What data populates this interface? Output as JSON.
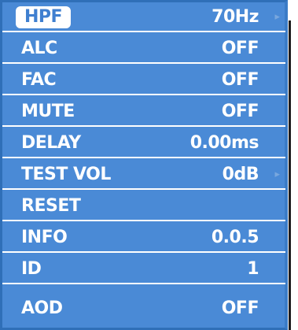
{
  "menu": {
    "items": [
      {
        "label": "HPF",
        "value": "70Hz"
      },
      {
        "label": "ALC",
        "value": "OFF"
      },
      {
        "label": "FAC",
        "value": "OFF"
      },
      {
        "label": "MUTE",
        "value": "OFF"
      },
      {
        "label": "DELAY",
        "value": "0.00ms"
      },
      {
        "label": "TEST VOL",
        "value": "0dB"
      },
      {
        "label": "RESET",
        "value": ""
      },
      {
        "label": "INFO",
        "value": "0.0.5"
      },
      {
        "label": "ID",
        "value": "1"
      },
      {
        "label": "AOD",
        "value": "OFF"
      }
    ]
  },
  "colors": {
    "panel": "#4a8ad6",
    "border": "#2f6fb8",
    "highlight_text": "#3f7fd0",
    "scroll_track": "#1d1d1f"
  },
  "icons": {
    "row_arrow": "triangle-right-icon"
  }
}
